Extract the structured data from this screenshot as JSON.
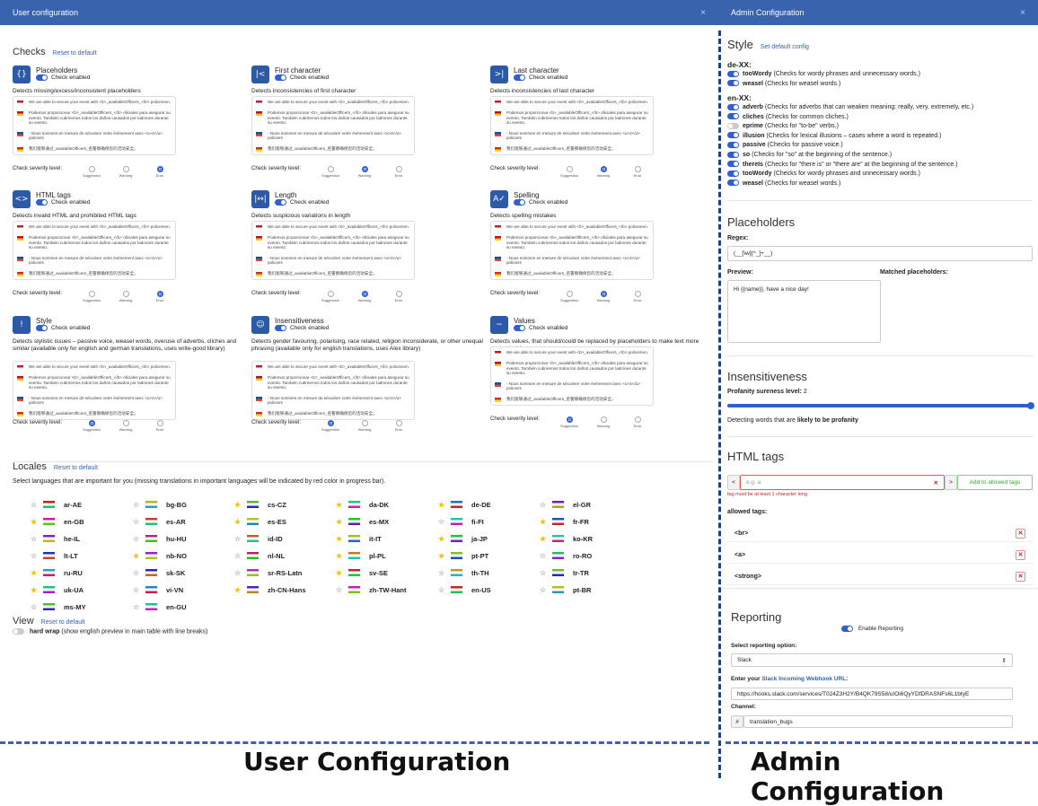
{
  "user": {
    "window_title": "User configuration",
    "close": "×",
    "checks_heading": "Checks",
    "reset": "Reset to default",
    "check_enabled": "Check enabled",
    "severity_label": "Check severity level:",
    "severity_options": [
      "Suggestion",
      "Warning",
      "Error"
    ],
    "checks": [
      {
        "name": "Placeholders",
        "icon": "{}",
        "desc": "Detects missing/excess/inconsistent placeholders",
        "sev": 2
      },
      {
        "name": "First character",
        "icon": "|<",
        "desc": "Detects inconsistencies of first character",
        "sev": 1
      },
      {
        "name": "Last character",
        "icon": ">|",
        "desc": "Detects inconsistencies of last character",
        "sev": 1
      },
      {
        "name": "HTML tags",
        "icon": "<>",
        "desc": "Detects invalid HTML and prohibited HTML tags",
        "sev": 2
      },
      {
        "name": "Length",
        "icon": "|↔|",
        "desc": "Detects suspicious variations in length",
        "sev": 1
      },
      {
        "name": "Spelling",
        "icon": "A✓",
        "desc": "Detects spelling mistakes",
        "sev": 1
      },
      {
        "name": "Style",
        "icon": "!",
        "desc": "Detects stylistic issues – passive voice, weasel words, overuse of adverbs, cliches and similar (available only for english and german translations, uses write-good library)",
        "sev": 0
      },
      {
        "name": "Insensitiveness",
        "icon": "☺",
        "desc": "Detects gender favouring, polarising, race related, religion inconsiderate, or other unequal phrasing (available only for english translations, uses Alex library)",
        "sev": 0
      },
      {
        "name": "Values",
        "icon": "~",
        "desc": "Detects values, that should/could be replaced by placeholders to make text more customizable",
        "sev": 0
      }
    ],
    "preview_lines": [
      "We are able to secure your event with <b>_availableOfficers_</b> policemen.",
      "Podemos proporcionar <b>_availableOfficers_</b> oficiales para asegurar su evento. También cubriremos todos los daños causados por ladrones durante su evento.",
      "- Nous sommes en mesure de sécuriser votre événement avec <u>4</u> policiers",
      "我们能够通过_availableOfficers_名警察确保您的活动安全。"
    ],
    "locales_heading": "Locales",
    "locales_reset": "Reset to default",
    "locales_desc": "Select languages that are important for you (missing translations in important languages will be indicated by red color in progress bar).",
    "locales": [
      {
        "code": "ar-AE",
        "star": false
      },
      {
        "code": "bg-BG",
        "star": false
      },
      {
        "code": "cs-CZ",
        "star": true
      },
      {
        "code": "da-DK",
        "star": true
      },
      {
        "code": "de-DE",
        "star": true
      },
      {
        "code": "el-GR",
        "star": false
      },
      {
        "code": "en-GB",
        "star": true
      },
      {
        "code": "es-AR",
        "star": false
      },
      {
        "code": "es-ES",
        "star": true
      },
      {
        "code": "es-MX",
        "star": true
      },
      {
        "code": "fi-FI",
        "star": false
      },
      {
        "code": "fr-FR",
        "star": true
      },
      {
        "code": "he-IL",
        "star": false
      },
      {
        "code": "hu-HU",
        "star": false
      },
      {
        "code": "id-ID",
        "star": false
      },
      {
        "code": "it-IT",
        "star": true
      },
      {
        "code": "ja-JP",
        "star": true
      },
      {
        "code": "ko-KR",
        "star": true
      },
      {
        "code": "lt-LT",
        "star": false
      },
      {
        "code": "nb-NO",
        "star": true
      },
      {
        "code": "nl-NL",
        "star": false
      },
      {
        "code": "pl-PL",
        "star": true
      },
      {
        "code": "pt-PT",
        "star": true
      },
      {
        "code": "ro-RO",
        "star": false
      },
      {
        "code": "ru-RU",
        "star": true
      },
      {
        "code": "sk-SK",
        "star": false
      },
      {
        "code": "sr-RS-Latn",
        "star": false
      },
      {
        "code": "sv-SE",
        "star": true
      },
      {
        "code": "th-TH",
        "star": false
      },
      {
        "code": "tr-TR",
        "star": false
      },
      {
        "code": "uk-UA",
        "star": true
      },
      {
        "code": "vi-VN",
        "star": false
      },
      {
        "code": "zh-CN-Hans",
        "star": true
      },
      {
        "code": "zh-TW-Hant",
        "star": false
      },
      {
        "code": "en-US",
        "star": false
      },
      {
        "code": "pt-BR",
        "star": false
      },
      {
        "code": "ms-MY",
        "star": false
      },
      {
        "code": "en-GU",
        "star": false
      }
    ],
    "view_heading": "View",
    "view_reset": "Reset to default",
    "hard_wrap": "hard wrap",
    "hard_wrap_desc": "(show english preview in main table with line breaks)"
  },
  "admin": {
    "window_title": "Admin Configuration",
    "close": "×",
    "style_heading": "Style",
    "set_default": "Set default config",
    "de_label": "de-XX:",
    "de_items": [
      {
        "name": "tooWordy",
        "desc": "(Checks for wordy phrases and unnecessary words.)",
        "on": true
      },
      {
        "name": "weasel",
        "desc": "(Checks for weasel words.)",
        "on": true
      }
    ],
    "en_label": "en-XX:",
    "en_items": [
      {
        "name": "adverb",
        "desc": "(Checks for adverbs that can weaken meaning: really, very, extremely, etc.)",
        "on": true
      },
      {
        "name": "cliches",
        "desc": "(Checks for common cliches.)",
        "on": true
      },
      {
        "name": "eprime",
        "desc": "(Checks for \"to-be\" verbs.)",
        "on": false
      },
      {
        "name": "illusion",
        "desc": "(Checks for lexical illusions – cases where a word is repeated.)",
        "on": true
      },
      {
        "name": "passive",
        "desc": "(Checks for passive voice.)",
        "on": true
      },
      {
        "name": "so",
        "desc": "(Checks for \"so\" at the beginning of the sentence.)",
        "on": true
      },
      {
        "name": "thereIs",
        "desc": "(Checks for \"there is\" or \"there are\" at the beginning of the sentence.)",
        "on": true
      },
      {
        "name": "tooWordy",
        "desc": "(Checks for wordy phrases and unnecessary words.)",
        "on": true
      },
      {
        "name": "weasel",
        "desc": "(Checks for weasel words.)",
        "on": true
      }
    ],
    "placeholders_heading": "Placeholders",
    "regex_label": "Regex:",
    "regex_value": "(__[\\w]{^_]+__)",
    "preview_label": "Preview:",
    "matched_label": "Matched placeholders:",
    "preview_value": "Hi {{name}}, have a nice day!",
    "insens_heading": "Insensitiveness",
    "profanity_label": "Profanity sureness level:",
    "profanity_value": "2",
    "profanity_level": 1.0,
    "detecting_text": "Detecting words that are",
    "detecting_bold": "likely to be profanity",
    "html_heading": "HTML tags",
    "tag_placeholder": "e.g. a",
    "tag_error": "tag must be at least 1 character long",
    "add_tag": "Add to allowed tags",
    "allowed_label": "allowed tags:",
    "allowed_tags": [
      "<br>",
      "<a>",
      "<strong>"
    ],
    "reporting_heading": "Reporting",
    "enable_reporting": "Enable Reporting",
    "select_reporting": "Select reporting option:",
    "reporting_option": "Slack",
    "webhook_label_pre": "Enter your",
    "webhook_label_link": "Slack Incoming Webhook URL",
    "webhook_value": "https://hooks.slack.com/services/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",
    "channel_label": "Channel:",
    "channel_value": "translation_bugs"
  },
  "captions": {
    "user": "User Configuration",
    "admin": "Admin Configuration"
  }
}
